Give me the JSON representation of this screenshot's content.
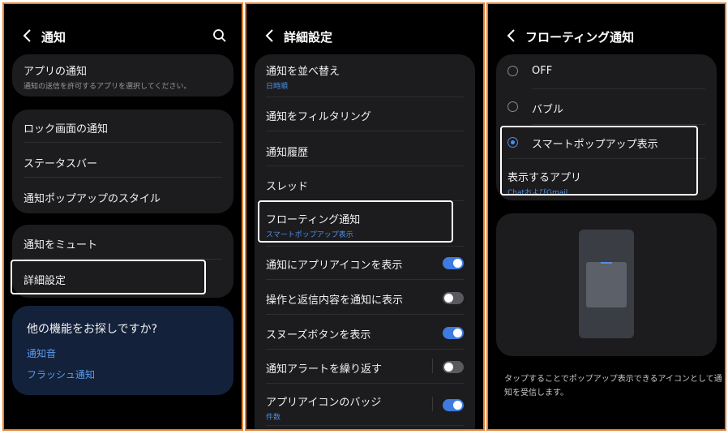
{
  "panel1": {
    "title": "通知",
    "app_notifications": {
      "label": "アプリの通知",
      "sub": "通知の送信を許可するアプリを選択してください。"
    },
    "lock_screen": "ロック画面の通知",
    "status_bar": "ステータスバー",
    "popup_style": "通知ポップアップのスタイル",
    "mute": "通知をミュート",
    "advanced": "詳細設定",
    "looking_for": {
      "title": "他の機能をお探しですか?",
      "link1": "通知音",
      "link2": "フラッシュ通知"
    }
  },
  "panel2": {
    "title": "詳細設定",
    "sort": {
      "label": "通知を並べ替え",
      "sub": "日時順"
    },
    "filter": "通知をフィルタリング",
    "history": "通知履歴",
    "threads": "スレッド",
    "floating": {
      "label": "フローティング通知",
      "sub": "スマートポップアップ表示"
    },
    "show_app_icon": {
      "label": "通知にアプリアイコンを表示",
      "on": true
    },
    "show_actions": {
      "label": "操作と返信内容を通知に表示",
      "on": false
    },
    "snooze": {
      "label": "スヌーズボタンを表示",
      "on": true
    },
    "repeat_alerts": {
      "label": "通知アラートを繰り返す",
      "on": false
    },
    "badges": {
      "label": "アプリアイコンのバッジ",
      "sub": "件数",
      "on": true
    }
  },
  "panel3": {
    "title": "フローティング通知",
    "options": [
      {
        "label": "OFF",
        "selected": false
      },
      {
        "label": "バブル",
        "selected": false
      },
      {
        "label": "スマートポップアップ表示",
        "selected": true
      }
    ],
    "apps_to_show": {
      "label": "表示するアプリ",
      "sub": "ChatおよびGmail"
    },
    "description": "タップすることでポップアップ表示できるアイコンとして通知を受信します。"
  },
  "colors": {
    "accent": "#3e7be0",
    "frame": "#e67e2e",
    "card": "#1c1c1e"
  },
  "icons": [
    "back-arrow-icon",
    "search-icon",
    "radio-icon",
    "toggle-icon"
  ]
}
